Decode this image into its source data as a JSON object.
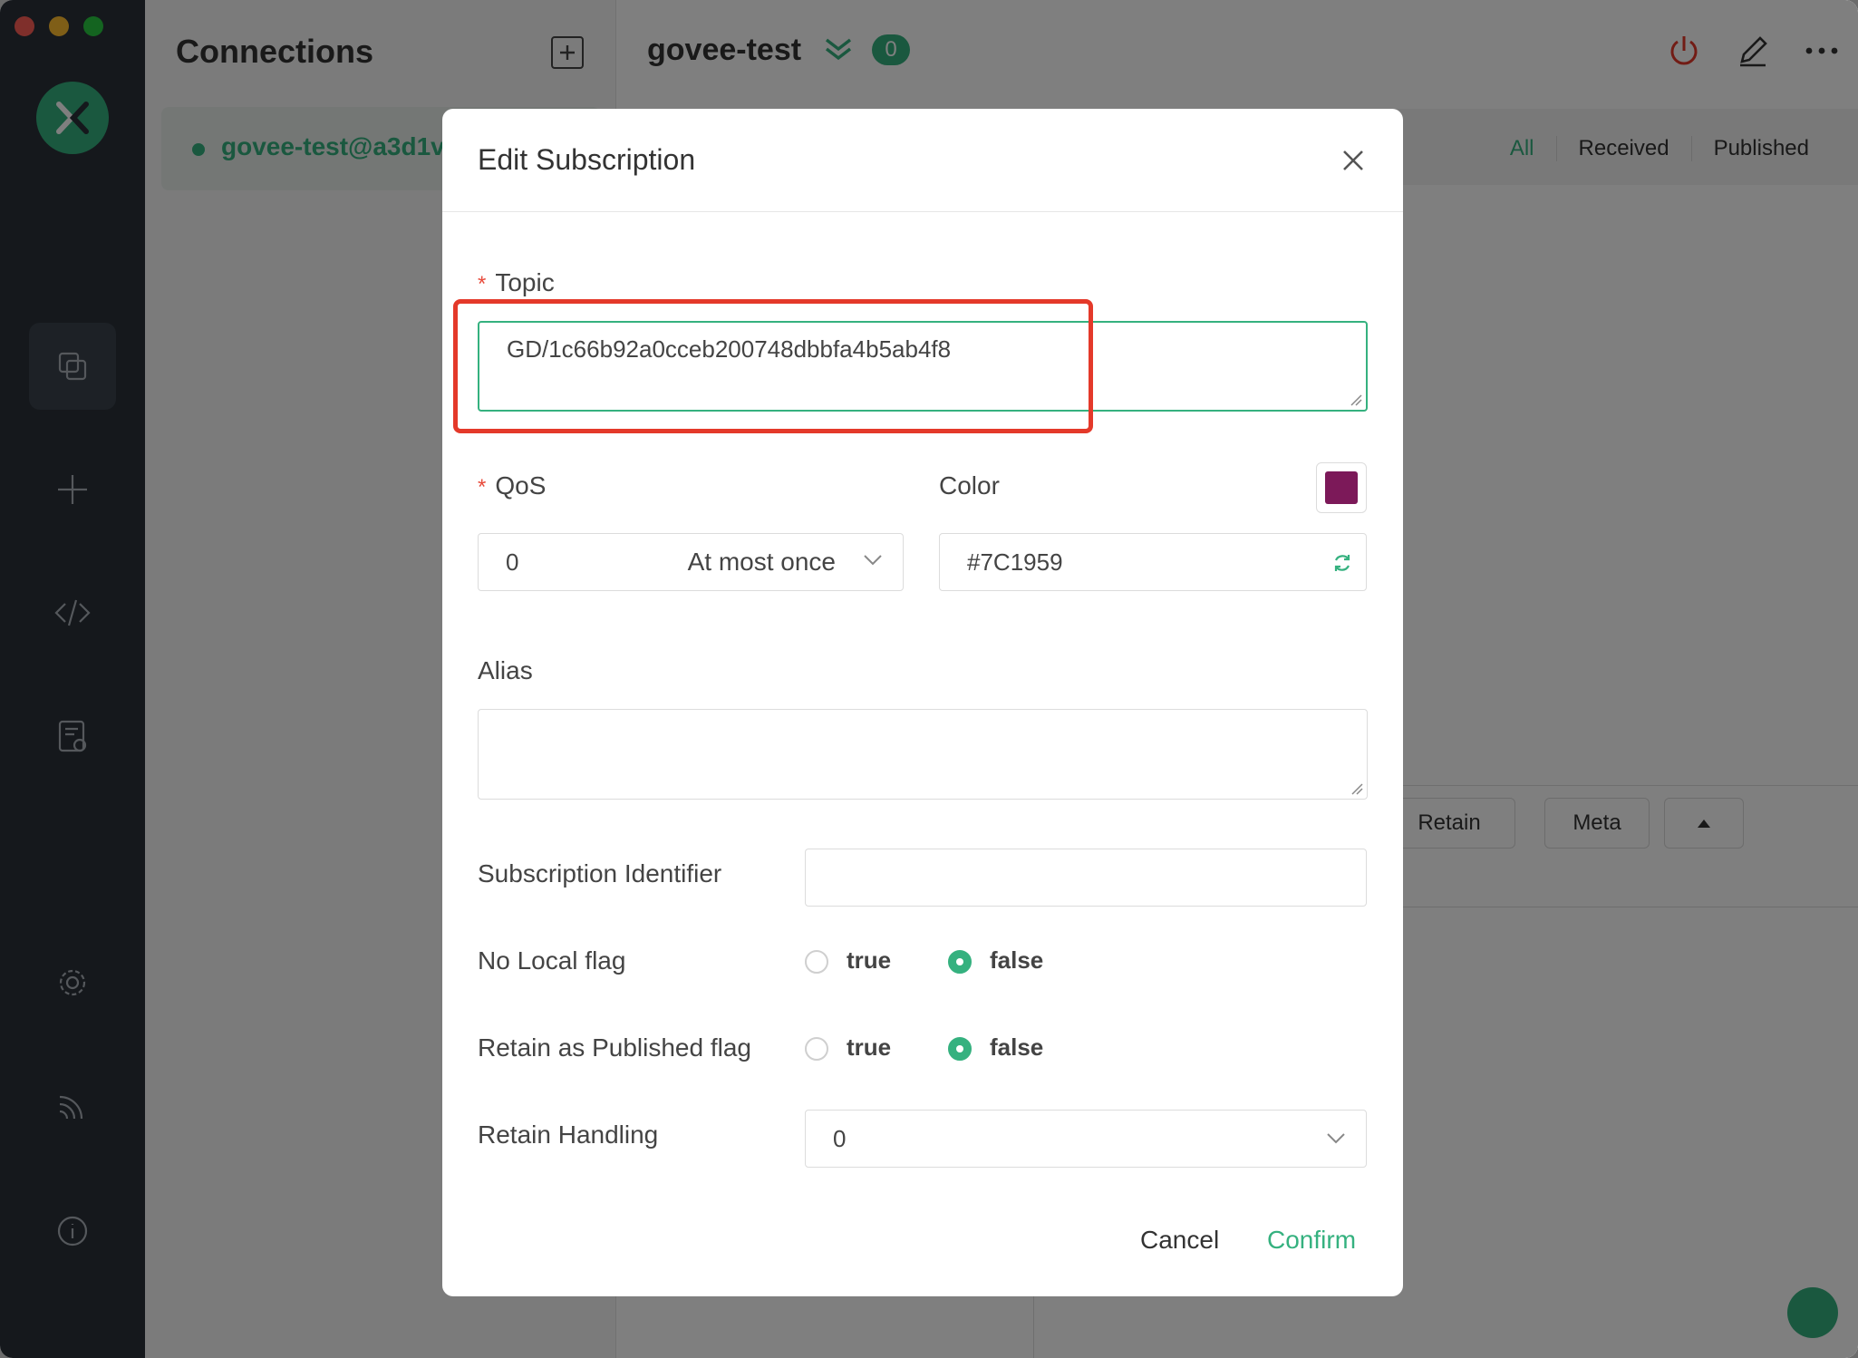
{
  "window": {
    "traffic_colors": [
      "#ff5f57",
      "#febc2e",
      "#28c840"
    ]
  },
  "leftbar": {
    "items": [
      {
        "icon": "connections-icon"
      },
      {
        "icon": "plus-icon"
      },
      {
        "icon": "code-icon"
      },
      {
        "icon": "log-icon"
      },
      {
        "icon": "gear-icon"
      },
      {
        "icon": "rss-icon"
      },
      {
        "icon": "info-icon"
      }
    ]
  },
  "connections": {
    "title": "Connections",
    "item_name": "govee-test@a3d1v"
  },
  "main": {
    "title": "govee-test",
    "badge": "0",
    "filters": [
      "All",
      "Received",
      "Published"
    ],
    "publish": {
      "retain_label": "Retain",
      "meta_label": "Meta"
    }
  },
  "dialog": {
    "title": "Edit Subscription",
    "topic": {
      "label": "Topic",
      "value": "GD/1c66b92a0cceb200748dbbfa4b5ab4f8"
    },
    "qos": {
      "label": "QoS",
      "value": "0",
      "description": "At most once"
    },
    "color": {
      "label": "Color",
      "value": "#7C1959",
      "swatch": "#7C1959"
    },
    "alias": {
      "label": "Alias",
      "value": ""
    },
    "subscription_identifier": {
      "label": "Subscription Identifier",
      "value": ""
    },
    "no_local": {
      "label": "No Local flag",
      "true_label": "true",
      "false_label": "false",
      "selected": "false"
    },
    "retain_as_published": {
      "label": "Retain as Published flag",
      "true_label": "true",
      "false_label": "false",
      "selected": "false"
    },
    "retain_handling": {
      "label": "Retain Handling",
      "value": "0"
    },
    "cancel_label": "Cancel",
    "confirm_label": "Confirm"
  },
  "colors": {
    "accent": "#35b17f",
    "required": "#e84b3c",
    "highlight": "#e4392a"
  }
}
